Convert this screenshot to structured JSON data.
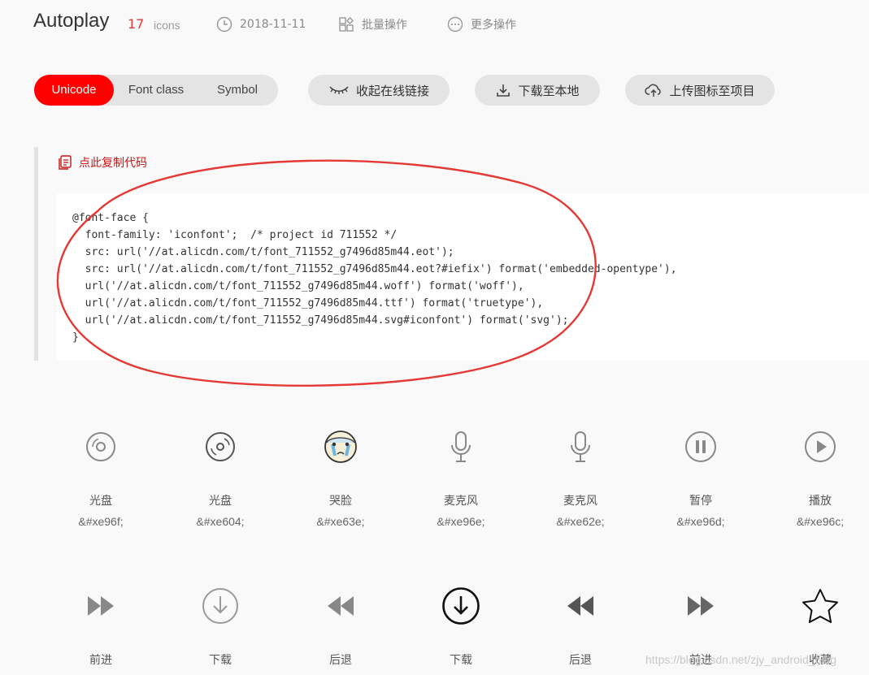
{
  "header": {
    "title": "Autoplay",
    "count": "17",
    "count_unit": "icons",
    "date": "2018-11-11",
    "batch": "批量操作",
    "more": "更多操作"
  },
  "tabs": [
    "Unicode",
    "Font class",
    "Symbol"
  ],
  "actions": {
    "collapse": "收起在线链接",
    "download": "下载至本地",
    "upload": "上传图标至项目"
  },
  "copy_label": "点此复制代码",
  "code_lines": [
    "@font-face {",
    "  font-family: 'iconfont';  /* project id 711552 */",
    "  src: url('//at.alicdn.com/t/font_711552_g7496d85m44.eot');",
    "  src: url('//at.alicdn.com/t/font_711552_g7496d85m44.eot?#iefix') format('embedded-opentype'),",
    "  url('//at.alicdn.com/t/font_711552_g7496d85m44.woff') format('woff'),",
    "  url('//at.alicdn.com/t/font_711552_g7496d85m44.ttf') format('truetype'),",
    "  url('//at.alicdn.com/t/font_711552_g7496d85m44.svg#iconfont') format('svg');",
    "}"
  ],
  "icons_row1": [
    {
      "name": "光盘",
      "code": "&#xe96f;",
      "icon": "disc-icon"
    },
    {
      "name": "光盘",
      "code": "&#xe604;",
      "icon": "disc-alt-icon"
    },
    {
      "name": "哭脸",
      "code": "&#xe63e;",
      "icon": "crying-face-icon"
    },
    {
      "name": "麦克风",
      "code": "&#xe96e;",
      "icon": "microphone-icon"
    },
    {
      "name": "麦克风",
      "code": "&#xe62e;",
      "icon": "microphone-alt-icon"
    },
    {
      "name": "暂停",
      "code": "&#xe96d;",
      "icon": "pause-icon"
    },
    {
      "name": "播放",
      "code": "&#xe96c;",
      "icon": "play-icon"
    }
  ],
  "icons_row2": [
    {
      "name": "前进",
      "icon": "fast-forward-icon"
    },
    {
      "name": "下载",
      "icon": "download-circle-icon"
    },
    {
      "name": "后退",
      "icon": "rewind-icon"
    },
    {
      "name": "下载",
      "icon": "download-circle-bold-icon"
    },
    {
      "name": "后退",
      "icon": "rewind-alt-icon"
    },
    {
      "name": "前进",
      "icon": "fast-forward-alt-icon"
    },
    {
      "name": "收藏",
      "icon": "star-icon"
    }
  ],
  "watermark": "https://blog.csdn.net/zjy_android_blog",
  "colors": {
    "accent": "#ff0000",
    "annotation": "#e53935",
    "copy_link": "#cc1414"
  }
}
